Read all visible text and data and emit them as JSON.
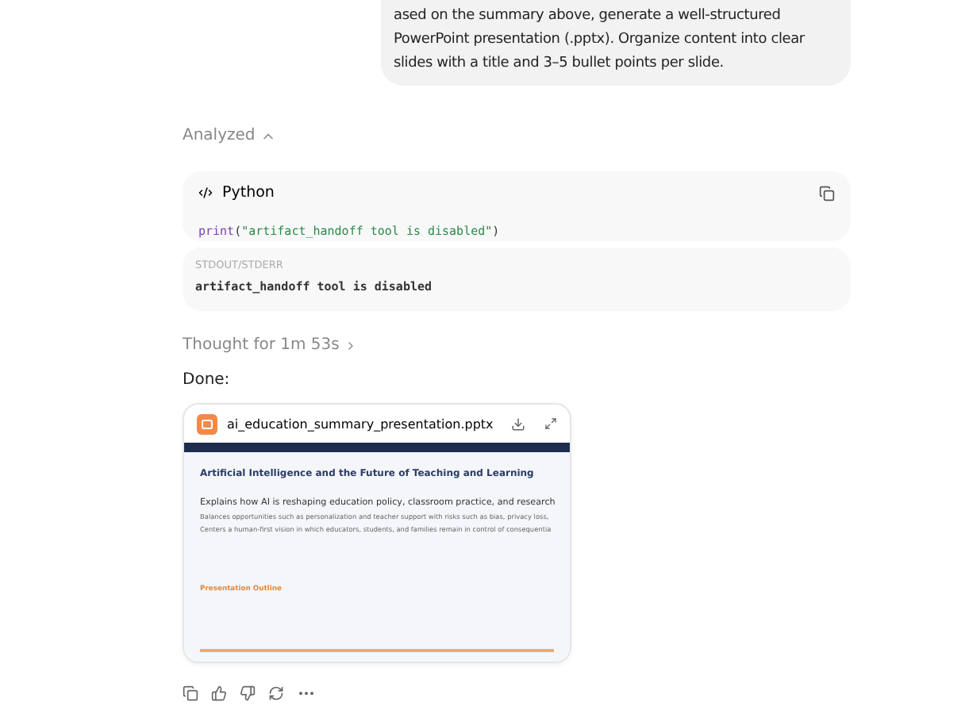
{
  "user_message": "ased on the summary above, generate a well-structured PowerPoint presentation (.pptx). Organize content into clear slides with a title and 3–5 bullet points per slide.",
  "analysis": {
    "label": "Analyzed",
    "expanded": true
  },
  "code_block": {
    "language": "Python",
    "code_tokens": [
      {
        "kind": "function",
        "text": "print"
      },
      {
        "kind": "punct",
        "text": "("
      },
      {
        "kind": "string",
        "text": "\"artifact_handoff tool is disabled\""
      },
      {
        "kind": "punct",
        "text": ")"
      }
    ]
  },
  "output_block": {
    "label": "STDOUT/STDERR",
    "text": "artifact_handoff tool is disabled"
  },
  "thought": "Thought for 1m 53s",
  "reply": "Done:",
  "file_card": {
    "filename": "ai_education_summary_presentation.pptx",
    "slide": {
      "title": "Artificial Intelligence and the Future of Teaching and Learning",
      "lead": "Explains how AI is reshaping education policy, classroom practice, and research",
      "bullets": [
        "Balances opportunities such as personalization and teacher support with risks such as bias, privacy loss,",
        "Centers a human-first vision in which educators, students, and families remain in control of consequentia"
      ],
      "section": "Presentation Outline"
    }
  }
}
